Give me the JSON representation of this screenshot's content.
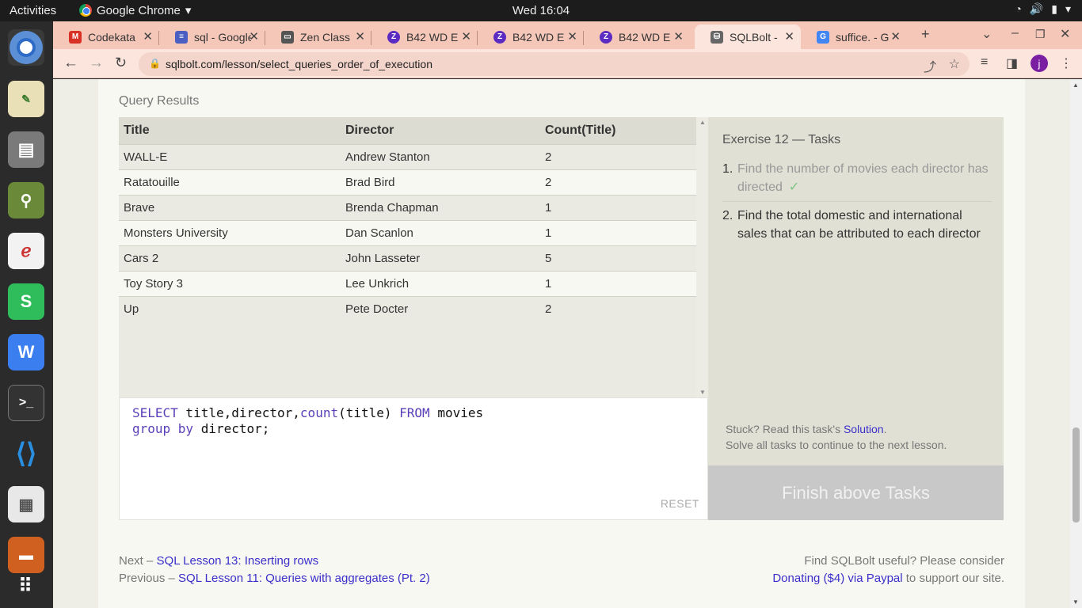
{
  "system": {
    "activities": "Activities",
    "app_name": "Google Chrome",
    "clock": "Wed 16:04"
  },
  "tabs": [
    {
      "label": "Codekata",
      "icon": "gmail-icon",
      "color": "#d93025"
    },
    {
      "label": "sql - Google",
      "icon": "docs-icon",
      "color": "#4a5fc1"
    },
    {
      "label": "Zen Class",
      "icon": "zen-icon",
      "color": "#555555"
    },
    {
      "label": "B42 WD E",
      "icon": "zoom-icon",
      "color": "#5b2bc2"
    },
    {
      "label": "B42 WD E",
      "icon": "zoom-icon",
      "color": "#5b2bc2"
    },
    {
      "label": "B42 WD E",
      "icon": "zoom-icon",
      "color": "#5b2bc2"
    },
    {
      "label": "SQLBolt -",
      "icon": "database-icon",
      "color": "#666666"
    },
    {
      "label": "suffice. - G",
      "icon": "google-icon",
      "color": "#4285f4"
    }
  ],
  "url": "sqlbolt.com/lesson/select_queries_order_of_execution",
  "profile_initial": "j",
  "page": {
    "query_results_title": "Query Results",
    "columns": [
      "Title",
      "Director",
      "Count(Title)"
    ],
    "rows": [
      [
        "WALL-E",
        "Andrew Stanton",
        "2"
      ],
      [
        "Ratatouille",
        "Brad Bird",
        "2"
      ],
      [
        "Brave",
        "Brenda Chapman",
        "1"
      ],
      [
        "Monsters University",
        "Dan Scanlon",
        "1"
      ],
      [
        "Cars 2",
        "John Lasseter",
        "5"
      ],
      [
        "Toy Story 3",
        "Lee Unkrich",
        "1"
      ],
      [
        "Up",
        "Pete Docter",
        "2"
      ]
    ],
    "query": {
      "kw_select": "SELECT",
      "fields_a": " title,director,",
      "fn_count": "count",
      "fields_b": "(title) ",
      "kw_from": "FROM",
      "table": " movies",
      "kw_group": "group by",
      "group_field": " director;"
    },
    "reset_label": "RESET",
    "exercise_title": "Exercise 12 — Tasks",
    "tasks": [
      {
        "num": "1.",
        "text": "Find the number of movies each director has directed",
        "done": true,
        "check": "✓"
      },
      {
        "num": "2.",
        "text": "Find the total domestic and international sales that can be attributed to each director",
        "done": false
      }
    ],
    "stuck_prefix": "Stuck? Read this task's ",
    "solution_link": "Solution",
    "stuck_suffix": ".",
    "solve_all": "Solve all tasks to continue to the next lesson.",
    "finish_button": "Finish above Tasks"
  },
  "footer": {
    "next_prefix": "Next – ",
    "next_link": "SQL Lesson 13: Inserting rows",
    "prev_prefix": "Previous – ",
    "prev_link": "SQL Lesson 11: Queries with aggregates (Pt. 2)",
    "useful_text": "Find SQLBolt useful? Please consider",
    "donate_link": "Donating ($4) via Paypal",
    "donate_suffix": " to support our site."
  }
}
